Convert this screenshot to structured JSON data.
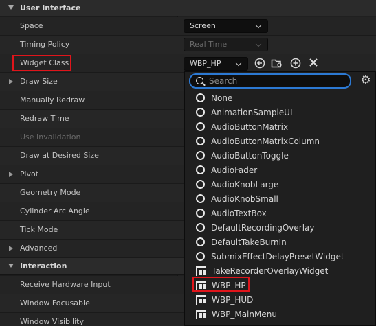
{
  "sections": {
    "user_interface": "User Interface",
    "interaction": "Interaction"
  },
  "properties": [
    {
      "label": "Space",
      "disabled": false,
      "expandable": false
    },
    {
      "label": "Timing Policy",
      "disabled": false,
      "expandable": false
    },
    {
      "label": "Widget Class",
      "disabled": false,
      "expandable": false
    },
    {
      "label": "Draw Size",
      "disabled": false,
      "expandable": true
    },
    {
      "label": "Manually Redraw",
      "disabled": false,
      "expandable": false
    },
    {
      "label": "Redraw Time",
      "disabled": false,
      "expandable": false
    },
    {
      "label": "Use Invalidation",
      "disabled": true,
      "expandable": false
    },
    {
      "label": "Draw at Desired Size",
      "disabled": false,
      "expandable": false
    },
    {
      "label": "Pivot",
      "disabled": false,
      "expandable": true
    },
    {
      "label": "Geometry Mode",
      "disabled": false,
      "expandable": false
    },
    {
      "label": "Cylinder Arc Angle",
      "disabled": false,
      "expandable": false
    },
    {
      "label": "Tick Mode",
      "disabled": false,
      "expandable": false
    },
    {
      "label": "Advanced",
      "disabled": false,
      "expandable": true
    }
  ],
  "interaction_properties": [
    {
      "label": "Receive Hardware Input"
    },
    {
      "label": "Window Focusable"
    },
    {
      "label": "Window Visibility"
    }
  ],
  "values": {
    "space": "Screen",
    "timing_policy": "Real Time",
    "widget_class": "WBP_HP"
  },
  "picker": {
    "search_placeholder": "Search",
    "items": [
      {
        "label": "None",
        "icon": "circle-icon"
      },
      {
        "label": "AnimationSampleUI",
        "icon": "circle-icon"
      },
      {
        "label": "AudioButtonMatrix",
        "icon": "circle-icon"
      },
      {
        "label": "AudioButtonMatrixColumn",
        "icon": "circle-icon"
      },
      {
        "label": "AudioButtonToggle",
        "icon": "circle-icon"
      },
      {
        "label": "AudioFader",
        "icon": "circle-icon"
      },
      {
        "label": "AudioKnobLarge",
        "icon": "circle-icon"
      },
      {
        "label": "AudioKnobSmall",
        "icon": "circle-icon"
      },
      {
        "label": "AudioTextBox",
        "icon": "circle-icon"
      },
      {
        "label": "DefaultRecordingOverlay",
        "icon": "circle-icon"
      },
      {
        "label": "DefaultTakeBurnIn",
        "icon": "circle-icon"
      },
      {
        "label": "SubmixEffectDelayPresetWidget",
        "icon": "circle-icon"
      },
      {
        "label": "TakeRecorderOverlayWidget",
        "icon": "widget-icon"
      },
      {
        "label": "WBP_HP",
        "icon": "widget-icon"
      },
      {
        "label": "WBP_HUD",
        "icon": "widget-icon"
      },
      {
        "label": "WBP_MainMenu",
        "icon": "widget-icon"
      }
    ]
  },
  "colors": {
    "highlight": "#e0151b",
    "search_focus": "#2c79d3"
  }
}
